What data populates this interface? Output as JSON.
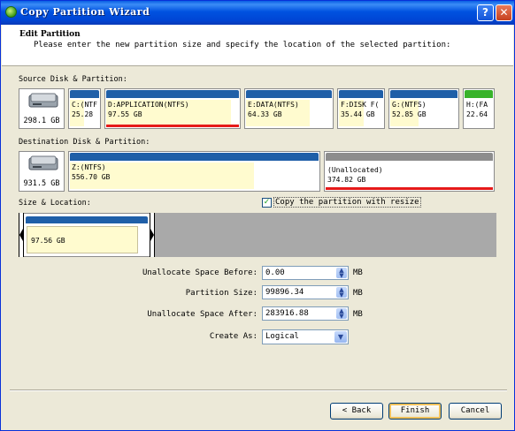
{
  "window": {
    "title": "Copy Partition Wizard",
    "help_glyph": "?",
    "close_glyph": "✕"
  },
  "header": {
    "title": "Edit Partition",
    "subtitle": "Please enter the new partition size and specify the location of the selected partition:"
  },
  "source": {
    "label": "Source Disk & Partition:",
    "disk_size": "298.1 GB",
    "partitions": [
      {
        "name": "C:(NTF",
        "size": "25.28",
        "color": "#1f5fa8"
      },
      {
        "name": "D:APPLICATION(NTFS)",
        "size": "97.55 GB",
        "color": "#1f5fa8",
        "selected": true
      },
      {
        "name": "E:DATA(NTFS)",
        "size": "64.33 GB",
        "color": "#1f5fa8"
      },
      {
        "name": "F:DISK F(",
        "size": "35.44 GB",
        "color": "#1f5fa8"
      },
      {
        "name": "G:(NTFS)",
        "size": "52.85 GB",
        "color": "#1f5fa8"
      },
      {
        "name": "H:(FA",
        "size": "22.64",
        "color": "#38b32a"
      }
    ]
  },
  "destination": {
    "label": "Destination Disk & Partition:",
    "disk_size": "931.5 GB",
    "partitions": [
      {
        "name": "Z:(NTFS)",
        "size": "556.70 GB",
        "color": "#1f5fa8"
      },
      {
        "name": "(Unallocated)",
        "size": "374.82 GB",
        "color": "#8d8d8d",
        "selected": true
      }
    ]
  },
  "size_location": {
    "label": "Size & Location:",
    "copy_resize_label": "Copy the partition with resize",
    "copy_resize_checked": true,
    "partition_size_text": "97.56 GB",
    "partition_fraction": 0.26
  },
  "fields": {
    "before_label": "Unallocate Space Before:",
    "before_value": "0.00",
    "size_label": "Partition Size:",
    "size_value": "99896.34",
    "after_label": "Unallocate Space After:",
    "after_value": "283916.88",
    "unit": "MB",
    "create_label": "Create As:",
    "create_value": "Logical"
  },
  "buttons": {
    "back": "< Back",
    "finish": "Finish",
    "cancel": "Cancel"
  }
}
